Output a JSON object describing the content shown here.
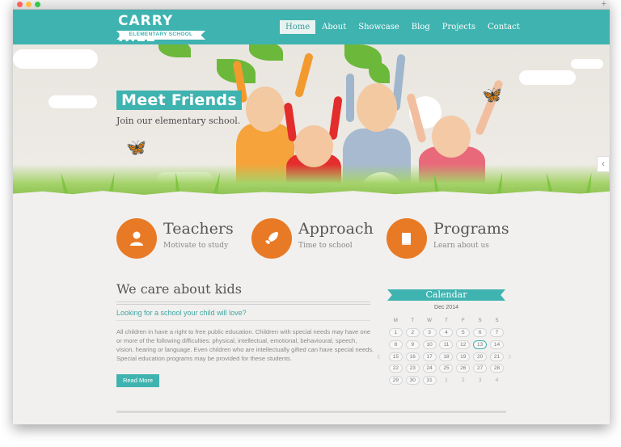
{
  "brand": {
    "title": "CARRY HILL",
    "subtitle": "ELEMENTARY SCHOOL"
  },
  "nav": {
    "items": [
      {
        "label": "Home"
      },
      {
        "label": "About"
      },
      {
        "label": "Showcase"
      },
      {
        "label": "Blog"
      },
      {
        "label": "Projects"
      },
      {
        "label": "Contact"
      }
    ]
  },
  "hero": {
    "title": "Meet Friends",
    "subtitle": "Join our elementary school.",
    "next_arrow": "‹"
  },
  "features": [
    {
      "title": "Teachers",
      "subtitle": "Motivate to study",
      "icon": "user-icon"
    },
    {
      "title": "Approach",
      "subtitle": "Time to school",
      "icon": "rocket-icon"
    },
    {
      "title": "Programs",
      "subtitle": "Learn about us",
      "icon": "book-icon"
    }
  ],
  "about": {
    "title": "We care about kids",
    "subtitle": "Looking for a school your child will love?",
    "body": "All children in have a right to free public education. Children with special needs may have one or more of the following difficulties: physical, intellectual, emotional, behavioural, speech, vision, hearing or language. Even children who are intellectually gifted can have special needs. Special education programs may be provided for these students.",
    "button": "Read More"
  },
  "calendar": {
    "title": "Calendar",
    "month": "Dec 2014",
    "weekdays": [
      "M",
      "T",
      "W",
      "T",
      "F",
      "S",
      "S"
    ],
    "weeks": [
      [
        "1",
        "2",
        "3",
        "4",
        "5",
        "6",
        "7"
      ],
      [
        "8",
        "9",
        "10",
        "11",
        "12",
        "13",
        "14"
      ],
      [
        "15",
        "16",
        "17",
        "18",
        "19",
        "20",
        "21"
      ],
      [
        "22",
        "23",
        "24",
        "25",
        "26",
        "27",
        "28"
      ],
      [
        "29",
        "30",
        "31",
        "1",
        "2",
        "3",
        "4"
      ]
    ],
    "today": "13",
    "prev": "‹",
    "next": "›"
  },
  "colors": {
    "accent": "#3fb3b0",
    "feature": "#e87a26"
  }
}
